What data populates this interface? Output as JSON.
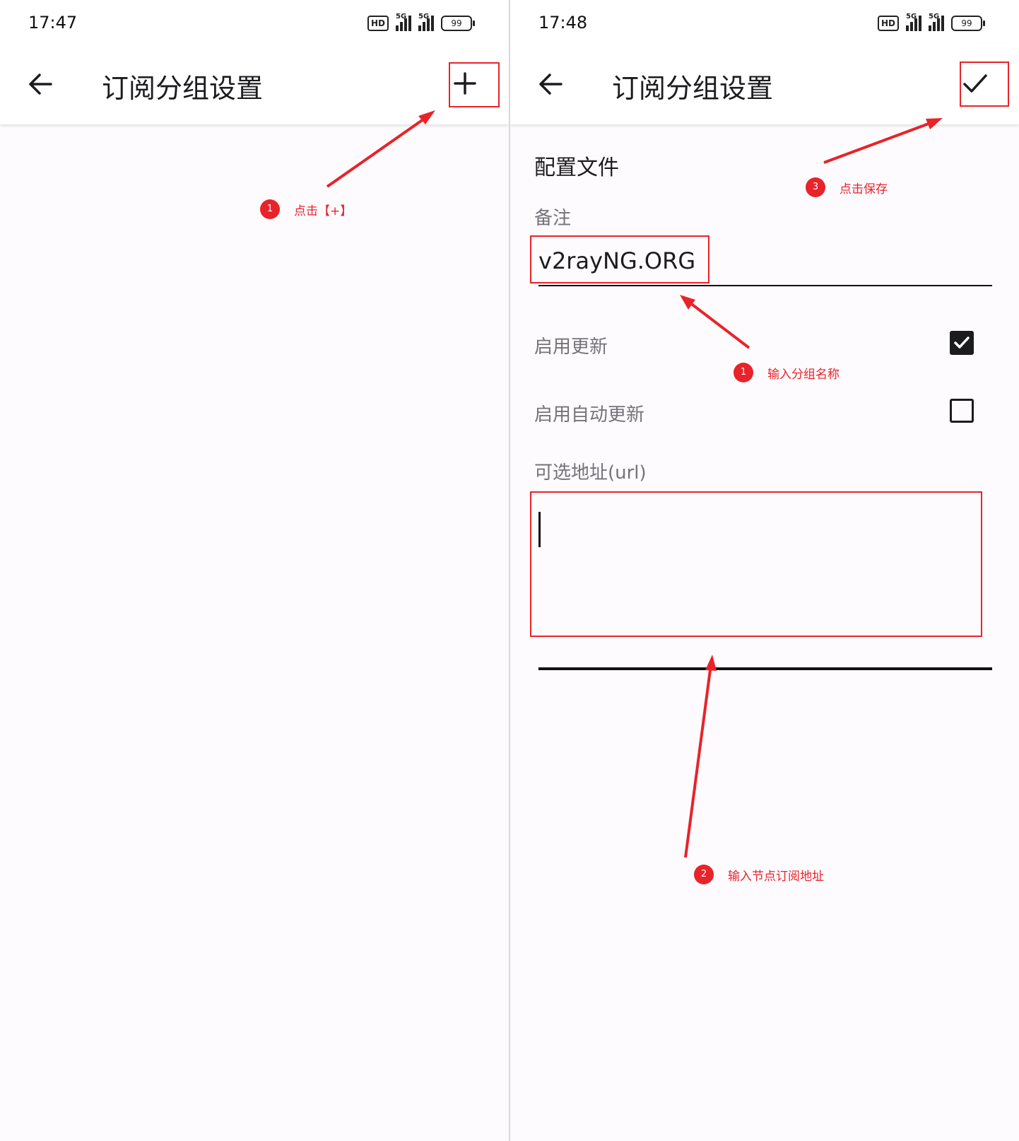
{
  "left": {
    "status": {
      "time": "17:47",
      "hd": "HD",
      "net1": "5G",
      "net2": "5G",
      "battery": "99"
    },
    "appbar": {
      "title": "订阅分组设置"
    },
    "annotation": {
      "step": "1",
      "text": "点击【+】"
    }
  },
  "right": {
    "status": {
      "time": "17:48",
      "hd": "HD",
      "net1": "5G",
      "net2": "5G",
      "battery": "99"
    },
    "appbar": {
      "title": "订阅分组设置"
    },
    "form": {
      "section_title": "配置文件",
      "remark_label": "备注",
      "remark_value": "v2rayNG.ORG",
      "enable_update_label": "启用更新",
      "enable_update_checked": true,
      "auto_update_label": "启用自动更新",
      "auto_update_checked": false,
      "url_label": "可选地址(url)",
      "url_value": ""
    },
    "annotations": [
      {
        "step": "1",
        "text": "输入分组名称"
      },
      {
        "step": "2",
        "text": "输入节点订阅地址"
      },
      {
        "step": "3",
        "text": "点击保存"
      }
    ]
  },
  "colors": {
    "annotation_red": "#e8232a",
    "panel_bg": "#fdfbfe",
    "text": "#1c1b1f",
    "label_gray": "#75737a"
  },
  "icons": [
    "arrow-back-icon",
    "add-icon",
    "check-icon",
    "signal-icon",
    "battery-icon",
    "checkbox-checked-icon",
    "checkbox-empty-icon"
  ]
}
